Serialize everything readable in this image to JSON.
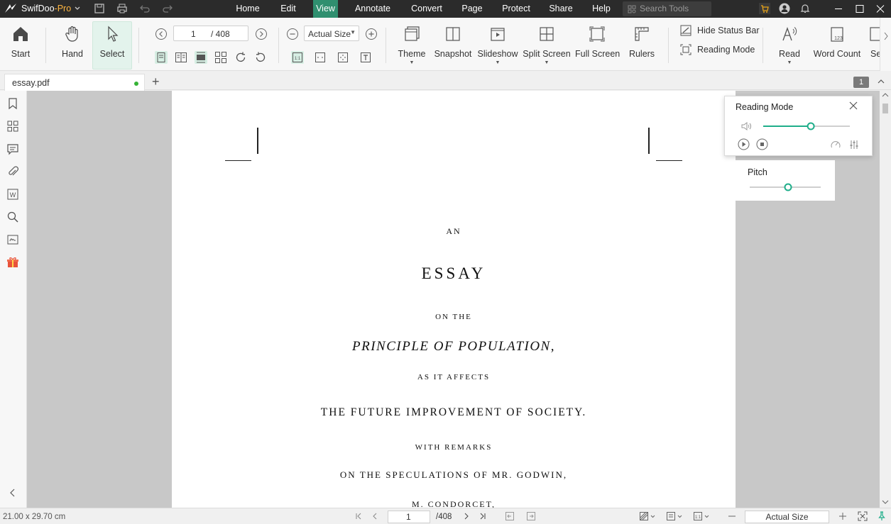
{
  "app": {
    "name": "SwifDoo",
    "edition": "-Pro"
  },
  "menu": {
    "items": [
      "Home",
      "Edit",
      "View",
      "Annotate",
      "Convert",
      "Page",
      "Protect",
      "Share",
      "Help"
    ],
    "active": "View",
    "search_placeholder": "Search Tools"
  },
  "ribbon": {
    "start": "Start",
    "hand": "Hand",
    "select": "Select",
    "current_page": "1",
    "total_pages": "/ 408",
    "zoom": "Actual Size",
    "theme": "Theme",
    "snapshot": "Snapshot",
    "slideshow": "Slideshow",
    "split_screen": "Split Screen",
    "full_screen": "Full Screen",
    "rulers": "Rulers",
    "hide_status_bar": "Hide Status Bar",
    "reading_mode": "Reading Mode",
    "read": "Read",
    "word_count": "Word Count",
    "cut_off": "Se"
  },
  "tabs": {
    "file": "essay.pdf",
    "page_badge": "1"
  },
  "document": {
    "line1": "AN",
    "line2": "ESSAY",
    "line3": "ON THE",
    "line4": "PRINCIPLE OF POPULATION,",
    "line5": "AS IT AFFECTS",
    "line6": "THE FUTURE IMPROVEMENT OF SOCIETY.",
    "line7": "WITH REMARKS",
    "line8": "ON THE SPECULATIONS OF MR. GODWIN,",
    "line9": "M. CONDORCET,"
  },
  "reading_panel": {
    "title": "Reading Mode",
    "volume": 0.55,
    "pitch_title": "Pitch",
    "pitch": 0.54
  },
  "status": {
    "page_size": "21.00 x 29.70 cm",
    "current_page": "1",
    "total_pages": "/408",
    "zoom": "Actual Size"
  },
  "colors": {
    "accent": "#2f8f6f",
    "slider": "#1fae8a",
    "titlebar": "#2b2b2b"
  }
}
